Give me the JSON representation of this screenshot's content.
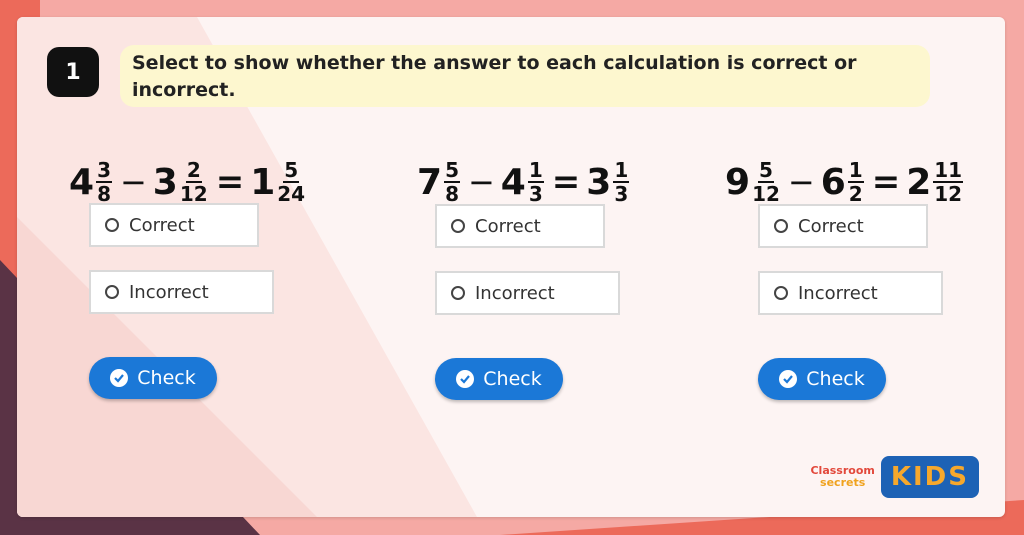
{
  "question": {
    "number": "1",
    "prompt": "Select to show whether the answer to each calculation is correct or incorrect."
  },
  "calculations": [
    {
      "a": {
        "whole": "4",
        "num": "3",
        "den": "8"
      },
      "op": "−",
      "b": {
        "whole": "3",
        "num": "2",
        "den": "12"
      },
      "eq": "=",
      "r": {
        "whole": "1",
        "num": "5",
        "den": "24"
      }
    },
    {
      "a": {
        "whole": "7",
        "num": "5",
        "den": "8"
      },
      "op": "−",
      "b": {
        "whole": "4",
        "num": "1",
        "den": "3"
      },
      "eq": "=",
      "r": {
        "whole": "3",
        "num": "1",
        "den": "3"
      }
    },
    {
      "a": {
        "whole": "9",
        "num": "5",
        "den": "12"
      },
      "op": "−",
      "b": {
        "whole": "6",
        "num": "1",
        "den": "2"
      },
      "eq": "=",
      "r": {
        "whole": "2",
        "num": "11",
        "den": "12"
      }
    }
  ],
  "options": {
    "correct": "Correct",
    "incorrect": "Incorrect"
  },
  "check_label": "Check",
  "branding": {
    "classroom": "Classroom",
    "secrets": "secrets",
    "kids": "KIDS"
  },
  "colors": {
    "background": "#f5a9a4",
    "accent_dark": "#5a3345",
    "accent_coral": "#ec6a5a",
    "prompt_bg": "#fdf7cf",
    "button": "#1b78d7"
  }
}
